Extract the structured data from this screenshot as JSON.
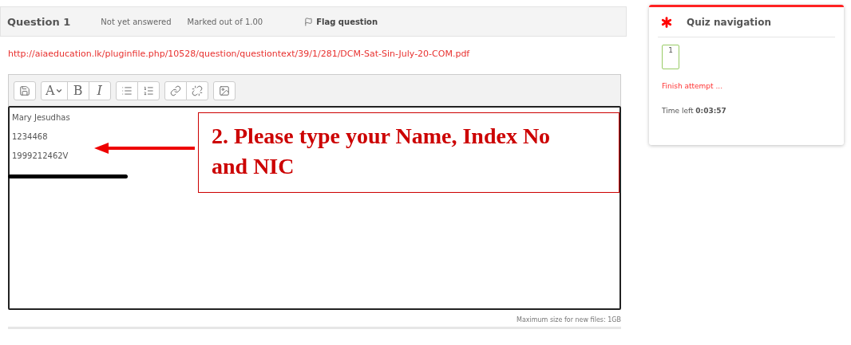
{
  "question": {
    "title": "Question 1",
    "status": "Not yet answered",
    "marks": "Marked out of 1.00",
    "flag": "Flag question"
  },
  "link": "http://aiaeducation.lk/pluginfile.php/10528/question/questiontext/39/1/281/DCM-Sat-Sin-July-20-COM.pdf",
  "toolbar": [
    [
      {
        "kind": "save"
      }
    ],
    [
      {
        "kind": "font",
        "label": "A"
      },
      {
        "kind": "text",
        "label": "B"
      },
      {
        "kind": "italic",
        "label": "I"
      }
    ],
    [
      {
        "kind": "bullets"
      },
      {
        "kind": "numbers"
      }
    ],
    [
      {
        "kind": "link"
      },
      {
        "kind": "unlink"
      }
    ],
    [
      {
        "kind": "image"
      }
    ]
  ],
  "editor_lines": [
    "Mary Jesudhas",
    "1234468",
    "1999212462V"
  ],
  "callout": "2. Please type your Name, Index No and NIC",
  "file_limit": "Maximum size for new files: 1GB",
  "nav": {
    "title": "Quiz navigation",
    "questions": [
      "1"
    ],
    "finish": "Finish attempt ...",
    "time_label": "Time left",
    "time": "0:03:57"
  }
}
